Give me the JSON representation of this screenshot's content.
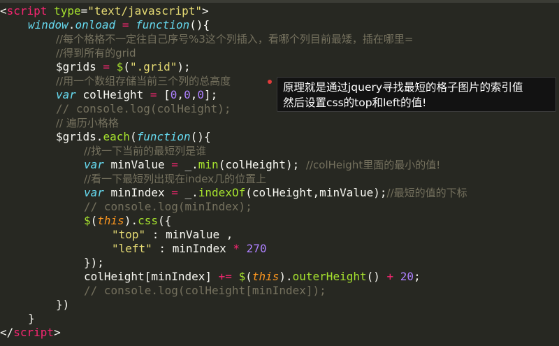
{
  "code": {
    "l1": {
      "a": "<",
      "b": "script",
      "c": " ",
      "d": "type",
      "e": "=",
      "f": "\"text/javascript\"",
      "g": ">"
    },
    "l2": {
      "a": "window",
      "b": ".",
      "c": "onload",
      "d": " = ",
      "e": "function",
      "f": "(){"
    },
    "l3": "//每个格格不一定往自己序号%3这个列插入，看哪个列目前最矮，插在哪里=",
    "l4": "//得到所有的grid",
    "l5": {
      "a": "$grids",
      "b": " = ",
      "c": "$",
      "d": "(",
      "e": "\".grid\"",
      "f": ");"
    },
    "l6": "//用一个数组存储当前三个列的总高度",
    "l7": {
      "a": "var",
      "b": " colHeight ",
      "c": "=",
      "d": " [",
      "e": "0",
      "f": ",",
      "g": "0",
      "h": ",",
      "i": "0",
      "j": "];"
    },
    "l8": "// console.log(colHeight);",
    "l9": "// 遍历小格格",
    "l10": {
      "a": "$grids",
      "b": ".",
      "c": "each",
      "d": "(",
      "e": "function",
      "f": "(){"
    },
    "l11": "//找一下当前的最短列是谁",
    "l12": {
      "a": "var",
      "b": " minValue ",
      "c": "=",
      "d": " _.",
      "e": "min",
      "f": "(colHeight); ",
      "g": "//colHeight里面的最小的值!"
    },
    "l13": "//看一下最短列出现在index几的位置上",
    "l14": {
      "a": "var",
      "b": " minIndex ",
      "c": "=",
      "d": " _.",
      "e": "indexOf",
      "f": "(colHeight,minValue);",
      "g": "//最短的值的下标"
    },
    "l15": "// console.log(minIndex);",
    "l16": {
      "a": "$",
      "b": "(",
      "c": "this",
      "d": ").",
      "e": "css",
      "f": "({"
    },
    "l17": {
      "a": "\"top\"",
      "b": " : minValue ,"
    },
    "l18": {
      "a": "\"left\"",
      "b": " : minIndex ",
      "c": "*",
      "d": " ",
      "e": "270"
    },
    "l19": "});",
    "l20": {
      "a": "colHeight[minIndex] ",
      "b": "+=",
      "c": " ",
      "d": "$",
      "e": "(",
      "f": "this",
      "g": ").",
      "h": "outerHeight",
      "i": "() ",
      "j": "+",
      "k": " ",
      "l": "20",
      "m": ";"
    },
    "l21": "// console.log(colHeight[minIndex]);",
    "l22": "})",
    "l23": "}",
    "l24": {
      "a": "</",
      "b": "script",
      "c": ">"
    }
  },
  "tooltip": {
    "line1": "原理就是通过jquery寻找最短的格子图片的索引值",
    "line2": "然后设置css的top和left的值!"
  },
  "colors": {
    "background": "#272822",
    "tag": "#f92672",
    "function": "#a6e22e",
    "string": "#e6db74",
    "comment": "#75715e",
    "keyword": "#66d9ef",
    "number": "#ae81ff",
    "this": "#fd971f"
  }
}
